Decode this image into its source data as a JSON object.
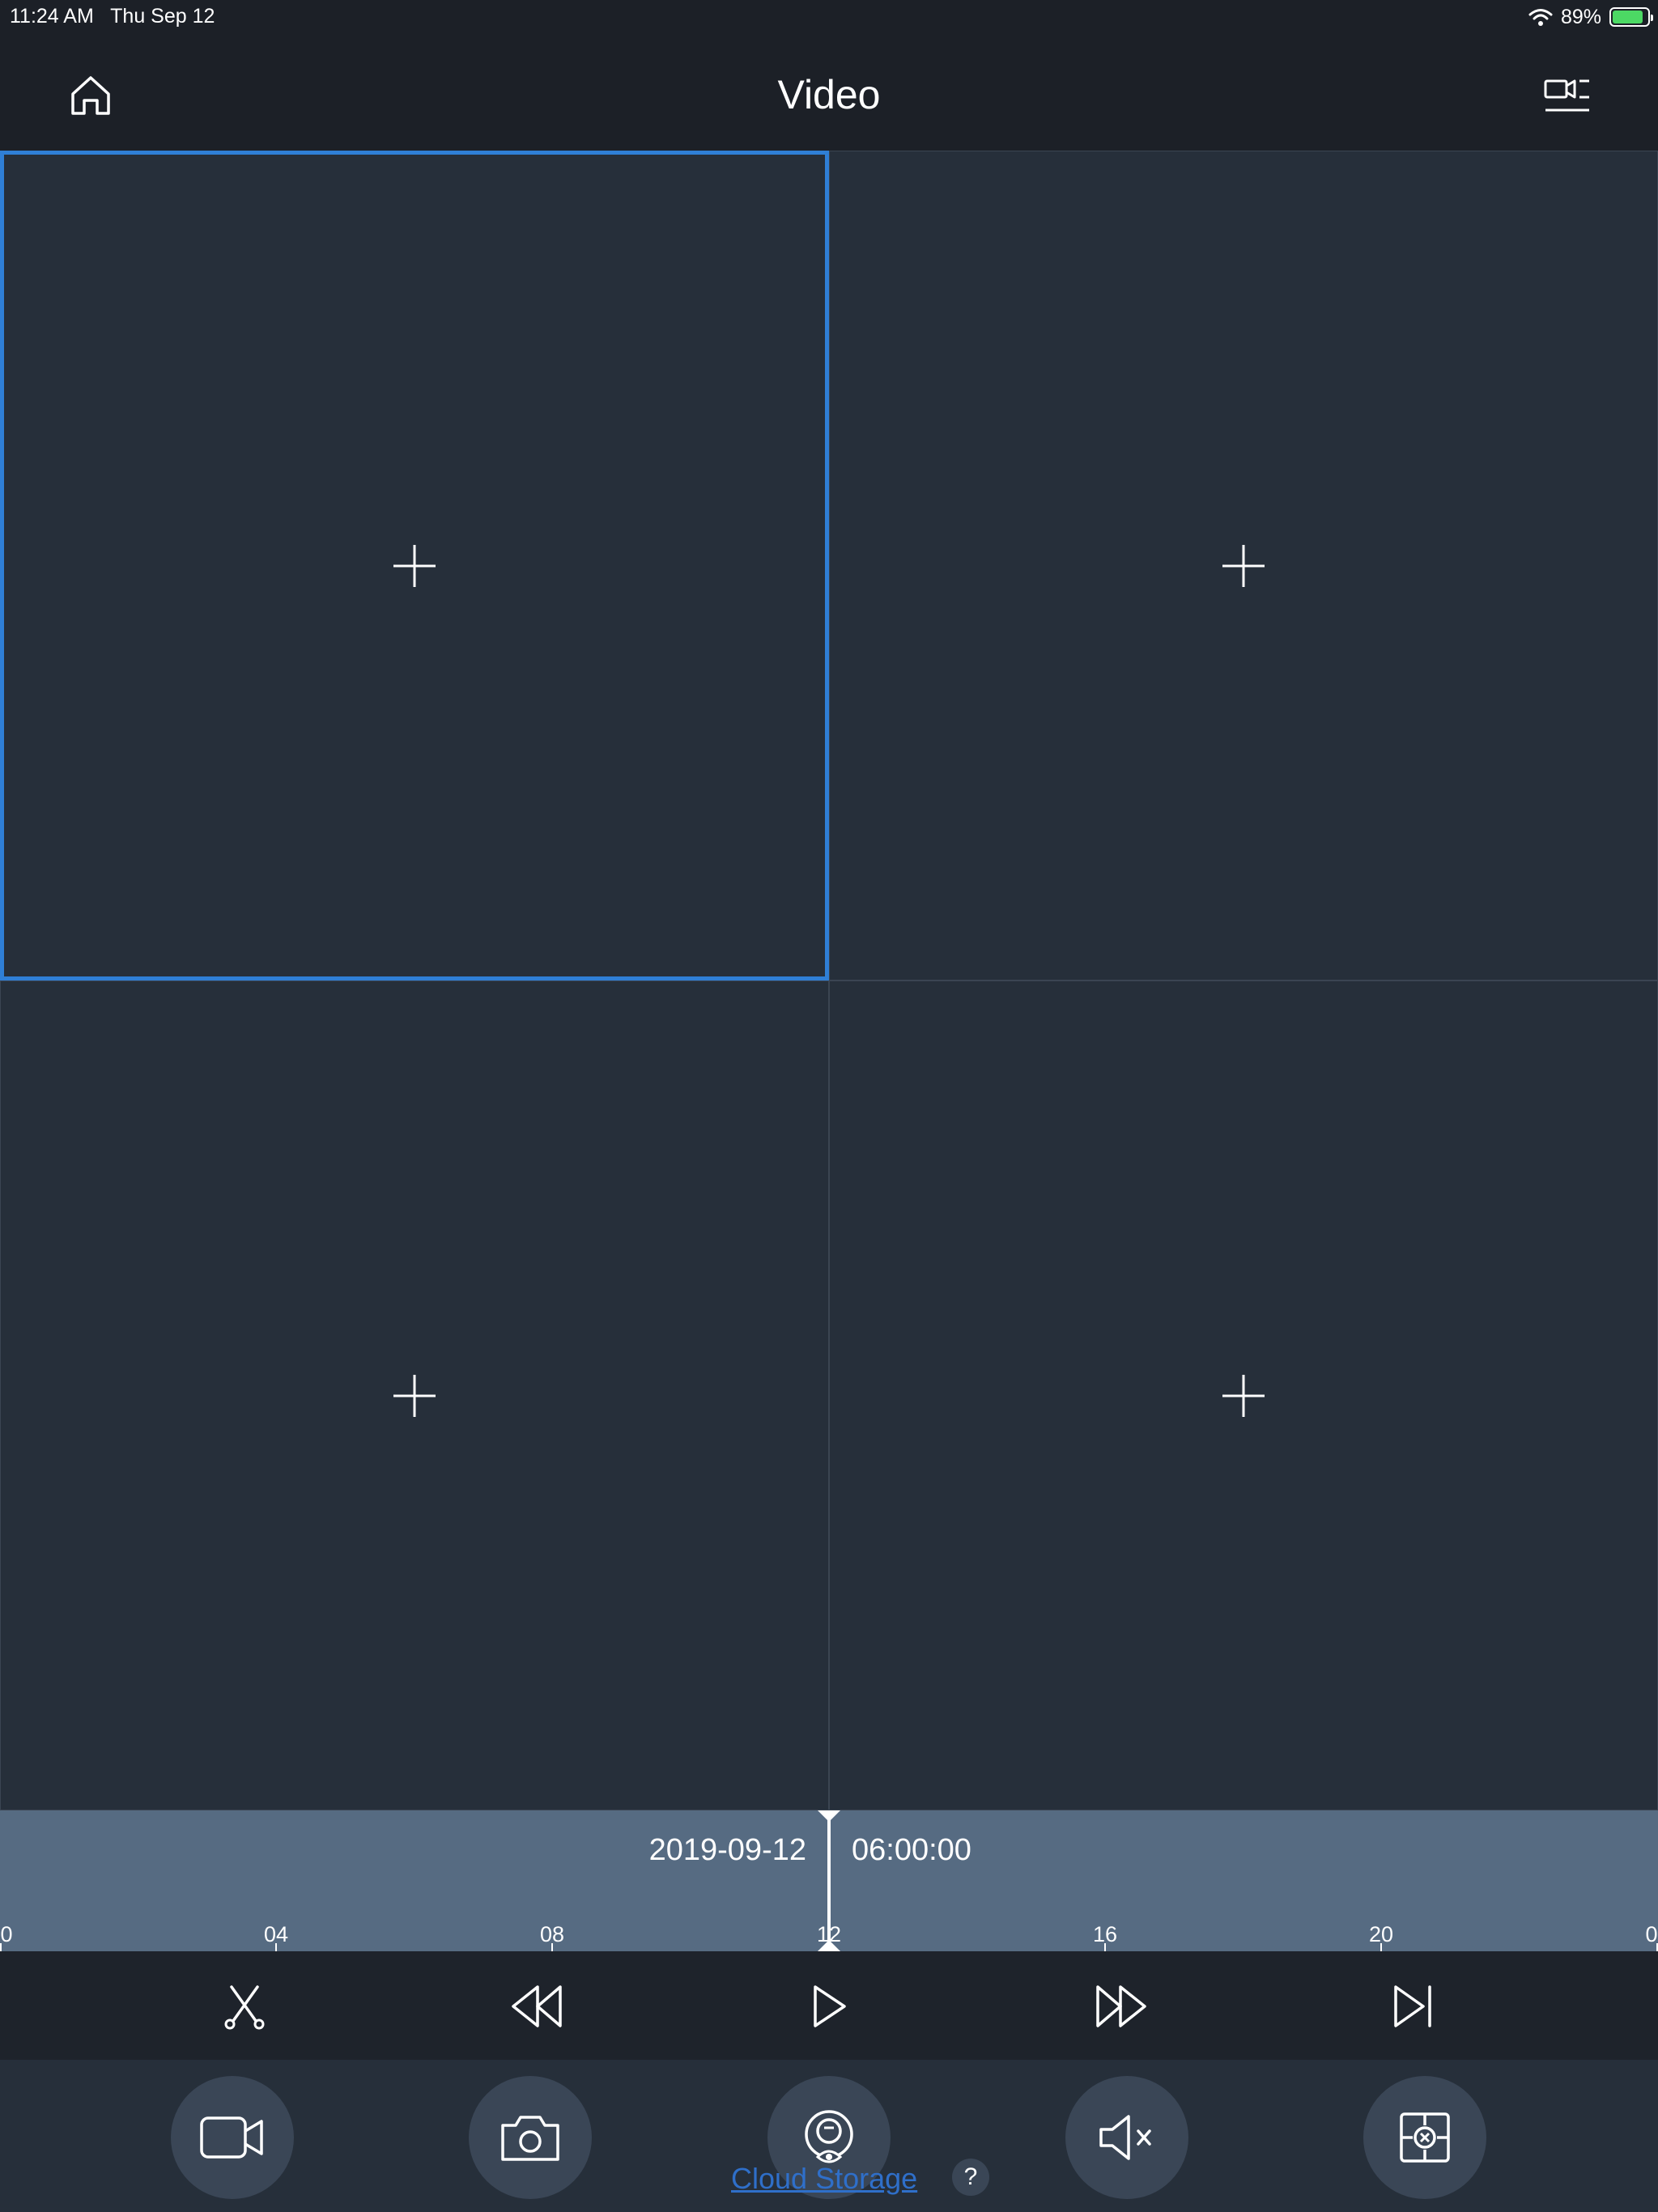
{
  "status_bar": {
    "time_date": "11:24 AM   Thu Sep 12",
    "battery": "89%",
    "battery_level": 0.89,
    "icons": [
      "wifi-icon",
      "battery-icon"
    ]
  },
  "header": {
    "title": "Video",
    "left_icon": "home-icon",
    "right_icon": "camera-list-icon"
  },
  "grid": {
    "cells": [
      {
        "icon": "add-icon",
        "selected": true
      },
      {
        "icon": "add-icon",
        "selected": false
      },
      {
        "icon": "add-icon",
        "selected": false
      },
      {
        "icon": "add-icon",
        "selected": false
      }
    ]
  },
  "timeline": {
    "date": "2019-09-12",
    "time": "06:00:00",
    "ticks": [
      "0",
      "04",
      "08",
      "12",
      "16",
      "20",
      "0"
    ]
  },
  "playback": {
    "icons": [
      "clip-icon",
      "rewind-icon",
      "play-icon",
      "fast-forward-icon",
      "skip-next-icon"
    ]
  },
  "toolbar": {
    "icons": [
      "record-icon",
      "snapshot-icon",
      "cloud-storage-icon",
      "mute-icon",
      "close-all-icon"
    ],
    "cloud_storage_label": "Cloud Storage",
    "help_label": "?"
  },
  "colors": {
    "background": "#1c2027",
    "cell_background": "#262f3a",
    "selection": "#2f7fd6",
    "timeline": "#566b82",
    "link": "#2f6fc9"
  }
}
